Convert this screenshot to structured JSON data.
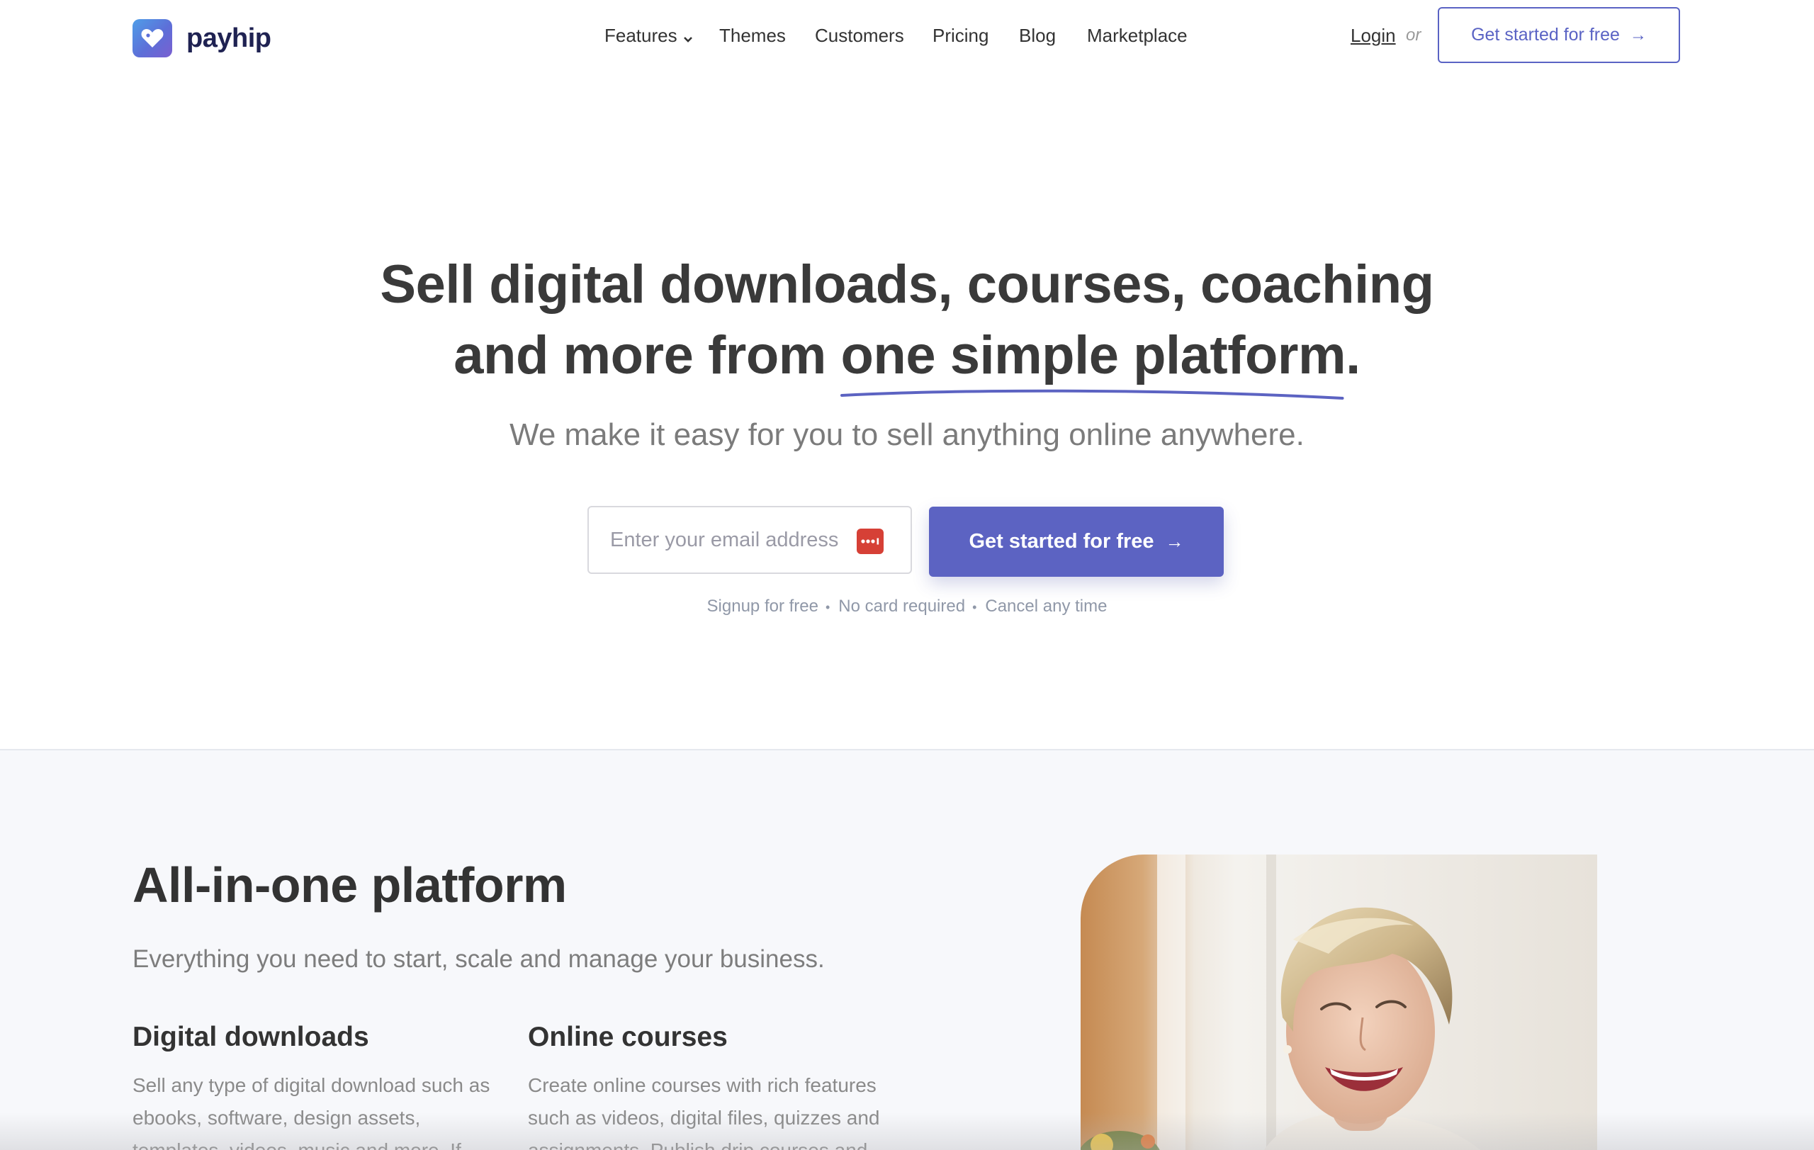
{
  "brand": {
    "name": "payhip",
    "accent": "#5c63c2",
    "logo_icon": "heart-tag-icon"
  },
  "nav": {
    "items": [
      "Features",
      "Themes",
      "Customers",
      "Pricing",
      "Blog",
      "Marketplace"
    ],
    "login": "Login",
    "or": "or",
    "cta": "Get started for free"
  },
  "hero": {
    "title_line1": "Sell digital downloads, courses, coaching",
    "title_line2_prefix": "and more from ",
    "title_line2_highlight": "one simple platform",
    "title_line2_suffix": ".",
    "subtitle": "We make it easy for you to sell anything online anywhere.",
    "email_placeholder": "Enter your email address",
    "password_manager_icon": "password-manager-icon",
    "cta": "Get started for free",
    "fine_print": [
      "Signup for free",
      "No card required",
      "Cancel any time"
    ]
  },
  "platform": {
    "title": "All-in-one platform",
    "subtitle": "Everything you need to start, scale and manage your business.",
    "features": [
      {
        "title": "Digital downloads",
        "description": "Sell any type of digital download such as ebooks, software, design assets, templates, videos, music and more. If"
      },
      {
        "title": "Online courses",
        "description": "Create online courses with rich features such as videos, digital files, quizzes and assignments. Publish drip courses and"
      }
    ],
    "image_alt": "smiling-woman-photo"
  }
}
